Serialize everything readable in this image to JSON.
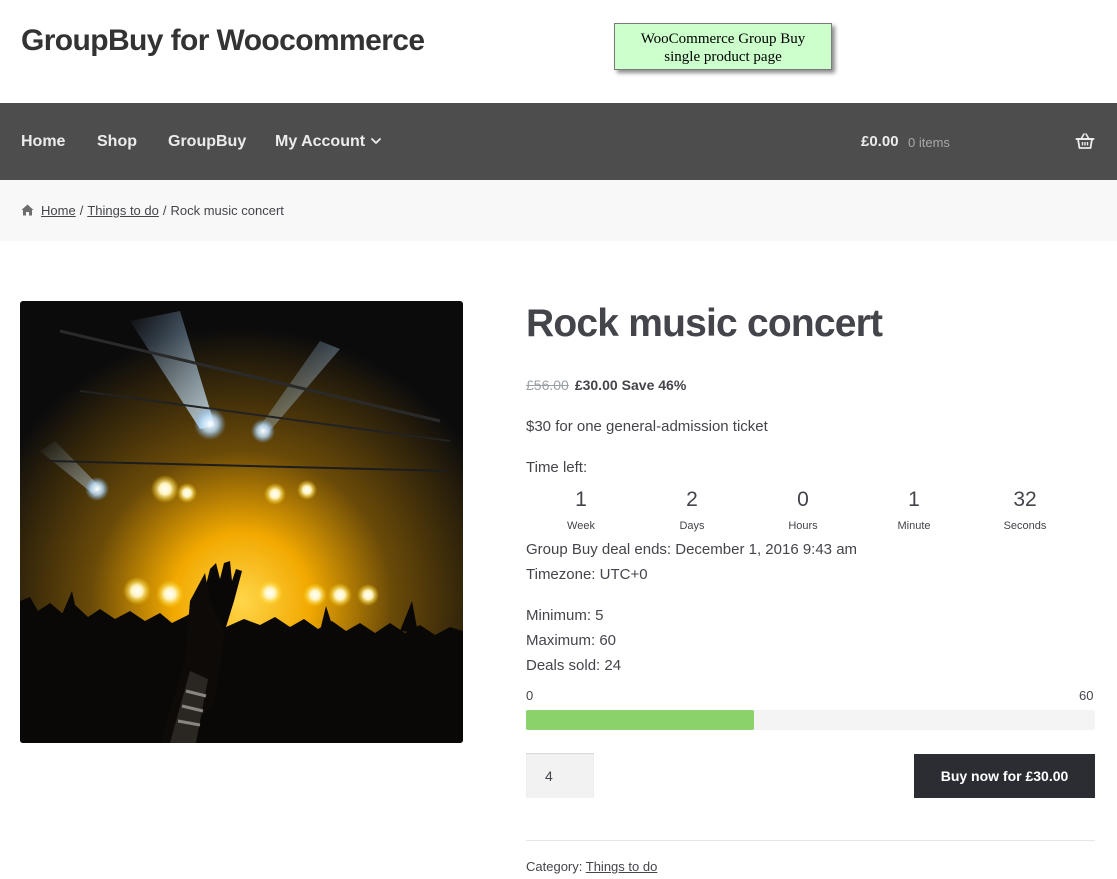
{
  "site": {
    "title": "GroupBuy for Woocommerce"
  },
  "annotation": {
    "line1": "WooCommerce Group Buy",
    "line2": "single product page"
  },
  "nav": {
    "items": [
      {
        "label": "Home"
      },
      {
        "label": "Shop"
      },
      {
        "label": "GroupBuy"
      },
      {
        "label": "My Account",
        "icon": "chevron-down-icon"
      }
    ],
    "cart": {
      "amount": "£0.00",
      "count": "0 items",
      "icon": "basket-icon"
    }
  },
  "breadcrumb": {
    "icon": "home-icon",
    "items": [
      "Home",
      "Things to do"
    ],
    "current": "Rock music concert",
    "separator": "/"
  },
  "product": {
    "image_alt": "Rock concert crowd under stage lights",
    "title": "Rock music concert",
    "price_old": "£56.00",
    "price_new": "£30.00",
    "save": "Save 46%",
    "short_description": "$30 for one general-admission ticket",
    "time_left_label": "Time left:",
    "countdown": [
      {
        "value": "1",
        "label": "Week"
      },
      {
        "value": "2",
        "label": "Days"
      },
      {
        "value": "0",
        "label": "Hours"
      },
      {
        "value": "1",
        "label": "Minute"
      },
      {
        "value": "32",
        "label": "Seconds"
      }
    ],
    "deal_ends": "Group Buy deal ends: December 1, 2016 9:43 am",
    "timezone": "Timezone: UTC+0",
    "minimum": "Minimum: 5",
    "maximum": "Maximum: 60",
    "deals_sold": "Deals sold: 24",
    "progress": {
      "min": "0",
      "max": "60",
      "value": 24
    },
    "quantity": "4",
    "buy_label": "Buy now for £30.00",
    "category_label": "Category:",
    "category": "Things to do"
  },
  "colors": {
    "nav_bg": "#4d4d4d",
    "progress_fill": "#8bd26a",
    "button_bg": "#2c2d33",
    "note_bg": "#ccffcc"
  }
}
